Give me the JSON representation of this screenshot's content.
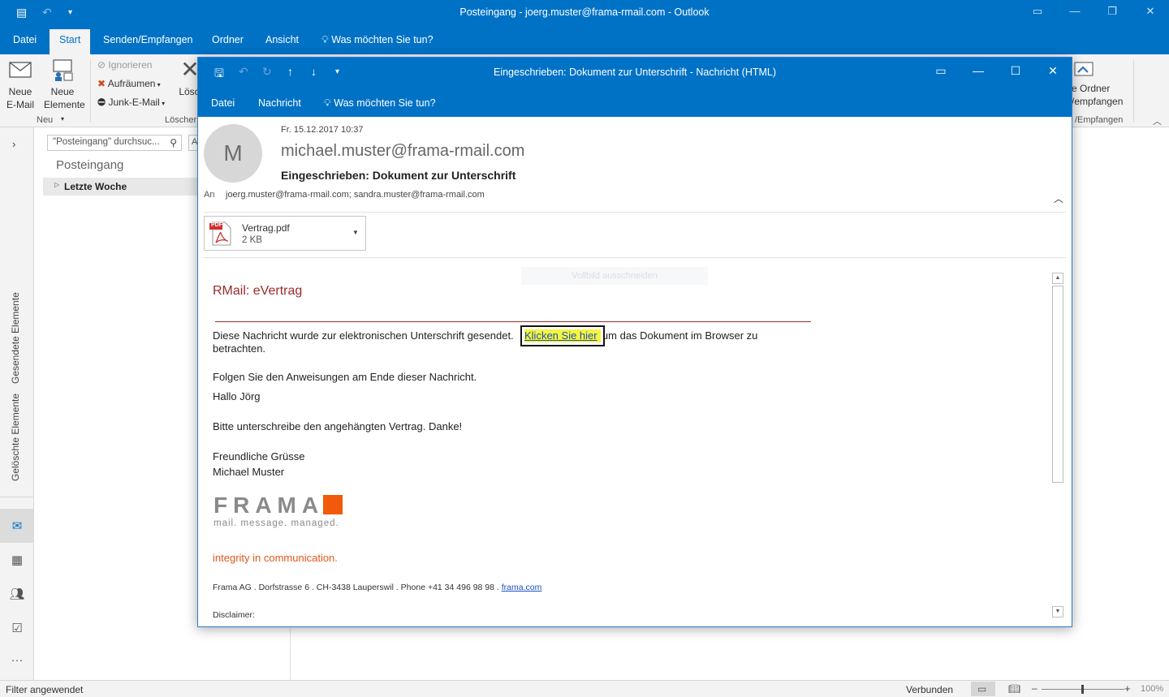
{
  "window": {
    "title": "Posteingang - joerg.muster@frama-rmail.com  -  Outlook"
  },
  "menu": {
    "tabs": [
      "Datei",
      "Start",
      "Senden/Empfangen",
      "Ordner",
      "Ansicht"
    ],
    "tell_me": "Was möchten Sie tun?"
  },
  "ribbon": {
    "new_email": [
      "Neue",
      "E-Mail"
    ],
    "new_items": [
      "Neue",
      "Elemente"
    ],
    "ignore": "Ignorieren",
    "cleanup": "Aufräumen",
    "junk": "Junk-E-Mail",
    "delete_partial": "Lösc",
    "group_new": "Neu",
    "group_delete": "Löscher",
    "right_label1": "e Ordner",
    "right_label2": "/empfangen",
    "right_group": "/Empfangen"
  },
  "leftnav": {
    "sent": "Gesendete Elemente",
    "deleted": "Gelöschte Elemente"
  },
  "folderpane": {
    "search_placeholder": "\"Posteingang\" durchsuc...",
    "folder_title": "Posteingang",
    "group": "Letzte Woche"
  },
  "statusbar": {
    "filter": "Filter angewendet",
    "connected": "Verbunden",
    "zoom": "100%"
  },
  "message_window": {
    "title": "Eingeschrieben: Dokument zur Unterschrift  -  Nachricht (HTML)",
    "menu": [
      "Datei",
      "Nachricht"
    ],
    "tell_me": "Was möchten Sie tun?",
    "avatar_letter": "M",
    "date": "Fr. 15.12.2017 10:37",
    "sender": "michael.muster@frama-rmail.com",
    "subject": "Eingeschrieben: Dokument zur Unterschrift",
    "to_label": "An",
    "to_value": "joerg.muster@frama-rmail.com; sandra.muster@frama-rmail.com",
    "attachment": {
      "badge": "PDF",
      "name": "Vertrag.pdf",
      "size": "2 KB"
    },
    "ghost_button": "Vollbild ausschneiden",
    "body": {
      "rmail_title": "RMail: eVertrag",
      "p1_before": "Diese Nachricht wurde zur elektronischen Unterschrift gesendet.",
      "link": "Klicken Sie hier",
      "p1_after": "um das Dokument im Browser zu betrachten.",
      "p2": "Folgen Sie den Anweisungen am Ende dieser Nachricht.",
      "p3": "Hallo Jörg",
      "p4": "Bitte unterschreibe den angehängten Vertrag. Danke!",
      "p5": "Freundliche Grüsse",
      "p6": "Michael Muster",
      "logo_word": "FRAMA",
      "logo_tag": "mail. message. managed.",
      "tagline": "integrity in communication.",
      "address": "Frama AG . Dorfstrasse 6 . CH-3438 Lauperswil . Phone +41 34 496 98 98 .",
      "address_link": "frama.com",
      "disclaimer": "Disclaimer:"
    }
  },
  "colors": {
    "accent": "#0072c6",
    "logo_orange": "#f15a0a",
    "rmail_red": "#9a2a2a",
    "tagline": "#e0571b",
    "link_highlight": "#f5f53d"
  }
}
